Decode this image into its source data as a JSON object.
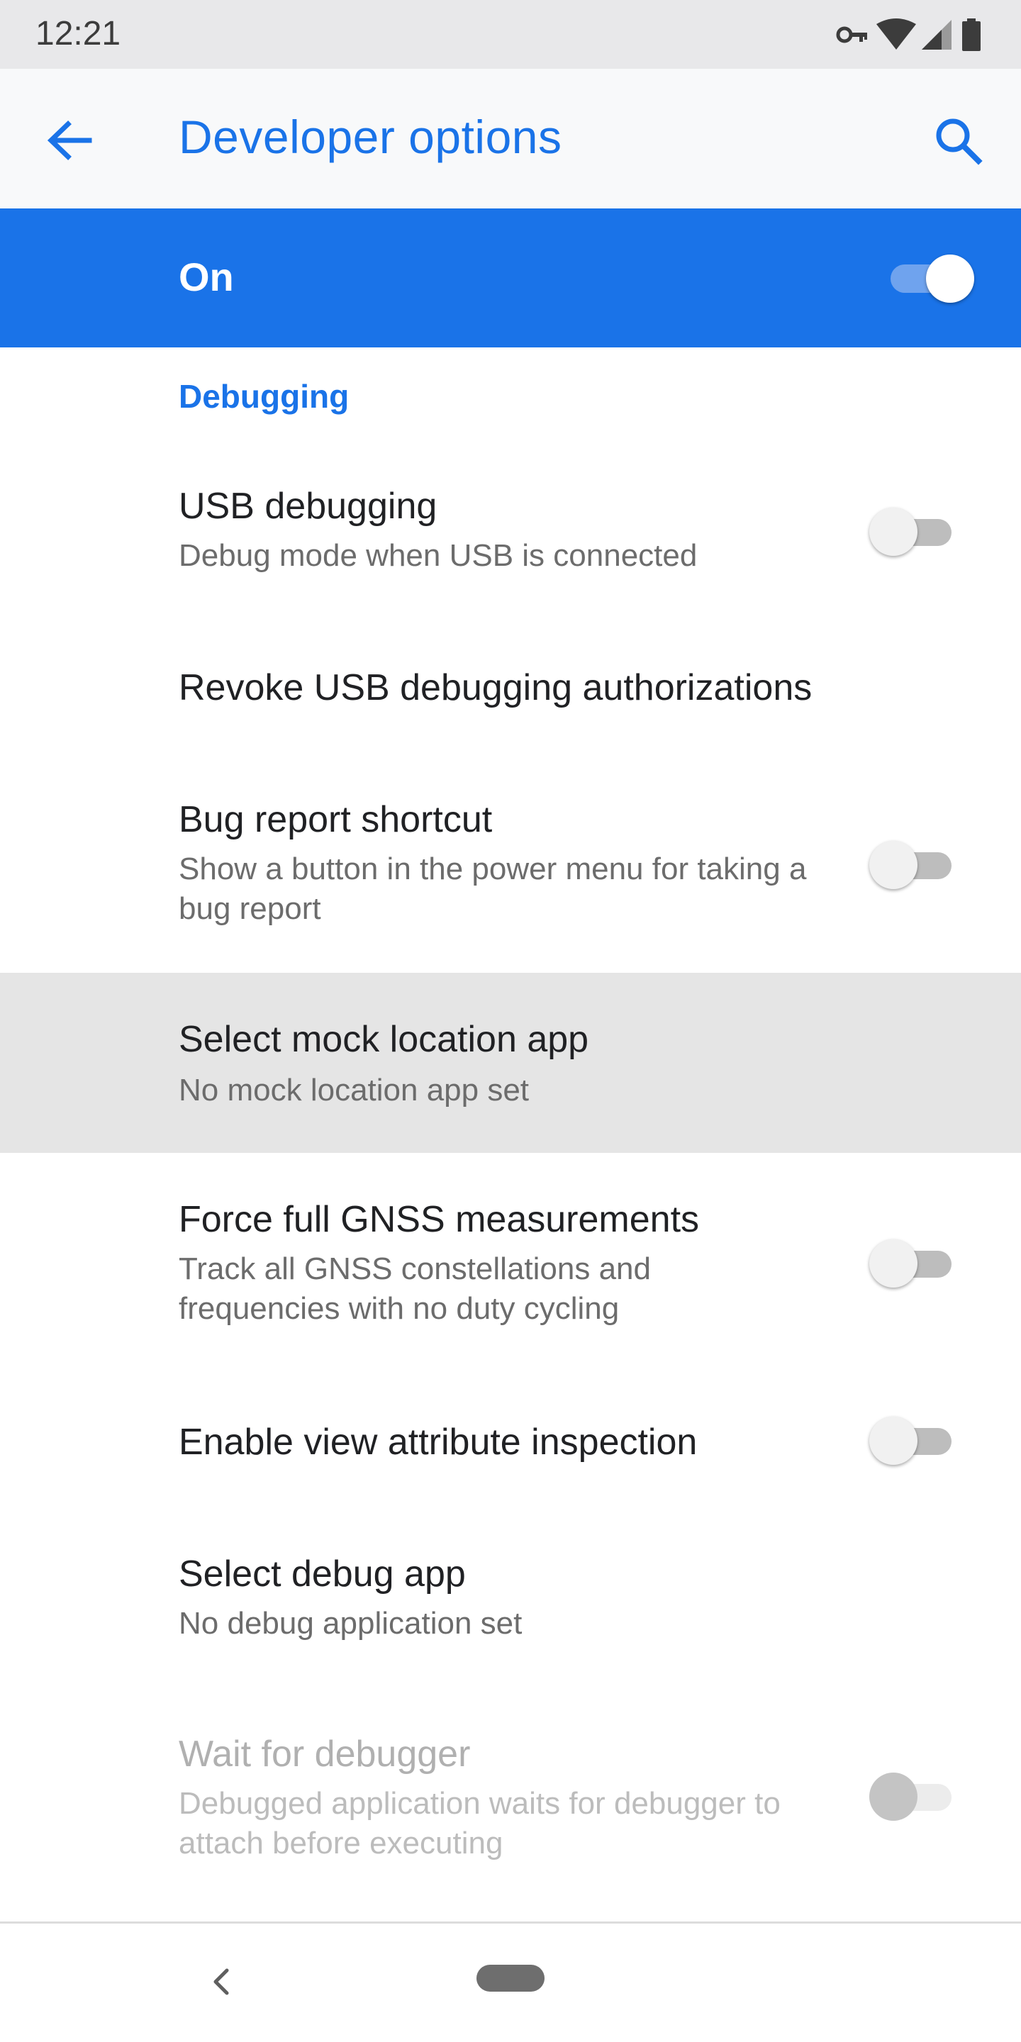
{
  "status_bar": {
    "time": "12:21",
    "icons": [
      "vpn-key-icon",
      "wifi-icon",
      "cellular-signal-icon",
      "battery-icon"
    ]
  },
  "app_bar": {
    "title": "Developer options",
    "back_icon": "arrow-back-icon",
    "search_icon": "search-icon"
  },
  "master_switch": {
    "label": "On",
    "state": "on"
  },
  "section": {
    "title": "Debugging"
  },
  "preferences": [
    {
      "title": "USB debugging",
      "summary": "Debug mode when USB is connected",
      "toggle": "off"
    },
    {
      "title": "Revoke USB debugging authorizations"
    },
    {
      "title": "Bug report shortcut",
      "summary": "Show a button in the power menu for taking a bug report",
      "toggle": "off"
    },
    {
      "title": "Select mock location app",
      "summary": "No mock location app set",
      "highlighted": true
    },
    {
      "title": "Force full GNSS measurements",
      "summary": "Track all GNSS constellations and frequencies with no duty cycling",
      "toggle": "off"
    },
    {
      "title": "Enable view attribute inspection",
      "toggle": "off"
    },
    {
      "title": "Select debug app",
      "summary": "No debug application set"
    },
    {
      "title": "Wait for debugger",
      "summary": "Debugged application waits for debugger to attach before executing",
      "toggle": "off",
      "disabled": true
    }
  ],
  "colors": {
    "accent": "#1a73e8",
    "highlight_row": "#e5e5e5",
    "status_bar": "#e8e8ea"
  },
  "nav_bar": {
    "icons": [
      "nav-back-icon",
      "home-pill"
    ]
  }
}
